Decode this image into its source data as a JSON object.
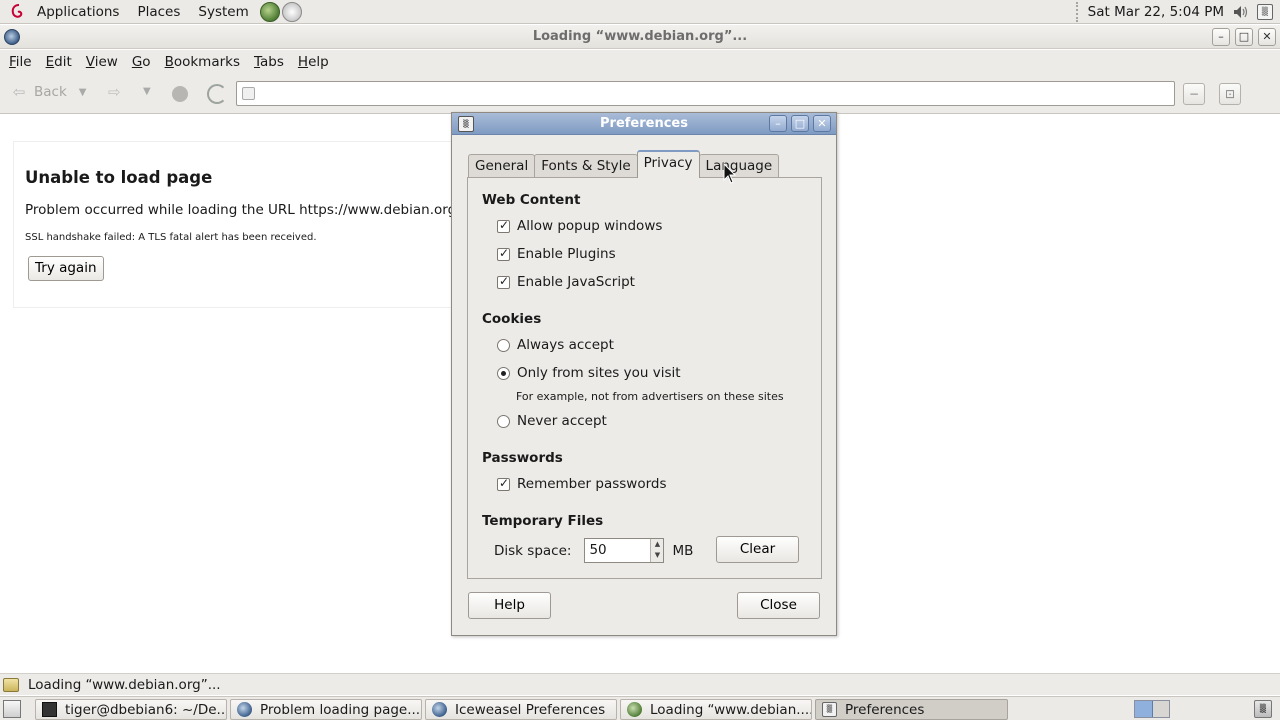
{
  "top_panel": {
    "menus": [
      "Applications",
      "Places",
      "System"
    ],
    "clock": "Sat Mar 22,  5:04 PM"
  },
  "window": {
    "title": "Loading “www.debian.org”...",
    "menubar": [
      "File",
      "Edit",
      "View",
      "Go",
      "Bookmarks",
      "Tabs",
      "Help"
    ],
    "toolbar": {
      "back_label": "Back",
      "url_value": ""
    }
  },
  "error_page": {
    "title": "Unable to load page",
    "message": "Problem occurred while loading the URL https://www.debian.org/",
    "detail": "SSL handshake failed: A TLS fatal alert has been received.",
    "try_again": "Try again"
  },
  "status_text": "Loading “www.debian.org”...",
  "taskbar": {
    "tasks": [
      {
        "label": "tiger@dbebian6: ~/De...",
        "icon": "terminal-icon"
      },
      {
        "label": "Problem loading page...",
        "icon": "browser-icon"
      },
      {
        "label": "Iceweasel Preferences",
        "icon": "browser-icon"
      },
      {
        "label": "Loading “www.debian....",
        "icon": "browser-icon"
      },
      {
        "label": "Preferences",
        "icon": "preferences-icon"
      }
    ]
  },
  "dialog": {
    "title": "Preferences",
    "tabs": [
      "General",
      "Fonts & Style",
      "Privacy",
      "Language"
    ],
    "selected_tab": "Privacy",
    "web_content": {
      "heading": "Web Content",
      "popups": "Allow popup windows",
      "plugins": "Enable Plugins",
      "javascript": "Enable JavaScript"
    },
    "cookies": {
      "heading": "Cookies",
      "always": "Always accept",
      "only_visit": "Only from sites you visit",
      "hint": "For example, not from advertisers on these sites",
      "never": "Never accept"
    },
    "passwords": {
      "heading": "Passwords",
      "remember": "Remember passwords"
    },
    "temp_files": {
      "heading": "Temporary Files",
      "disk_label": "Disk space:",
      "disk_value": "50",
      "unit": "MB",
      "clear": "Clear"
    },
    "help": "Help",
    "close": "Close"
  },
  "colors": {
    "dialog_title": "#7f9bc3",
    "panel_bg": "#eceae6"
  }
}
